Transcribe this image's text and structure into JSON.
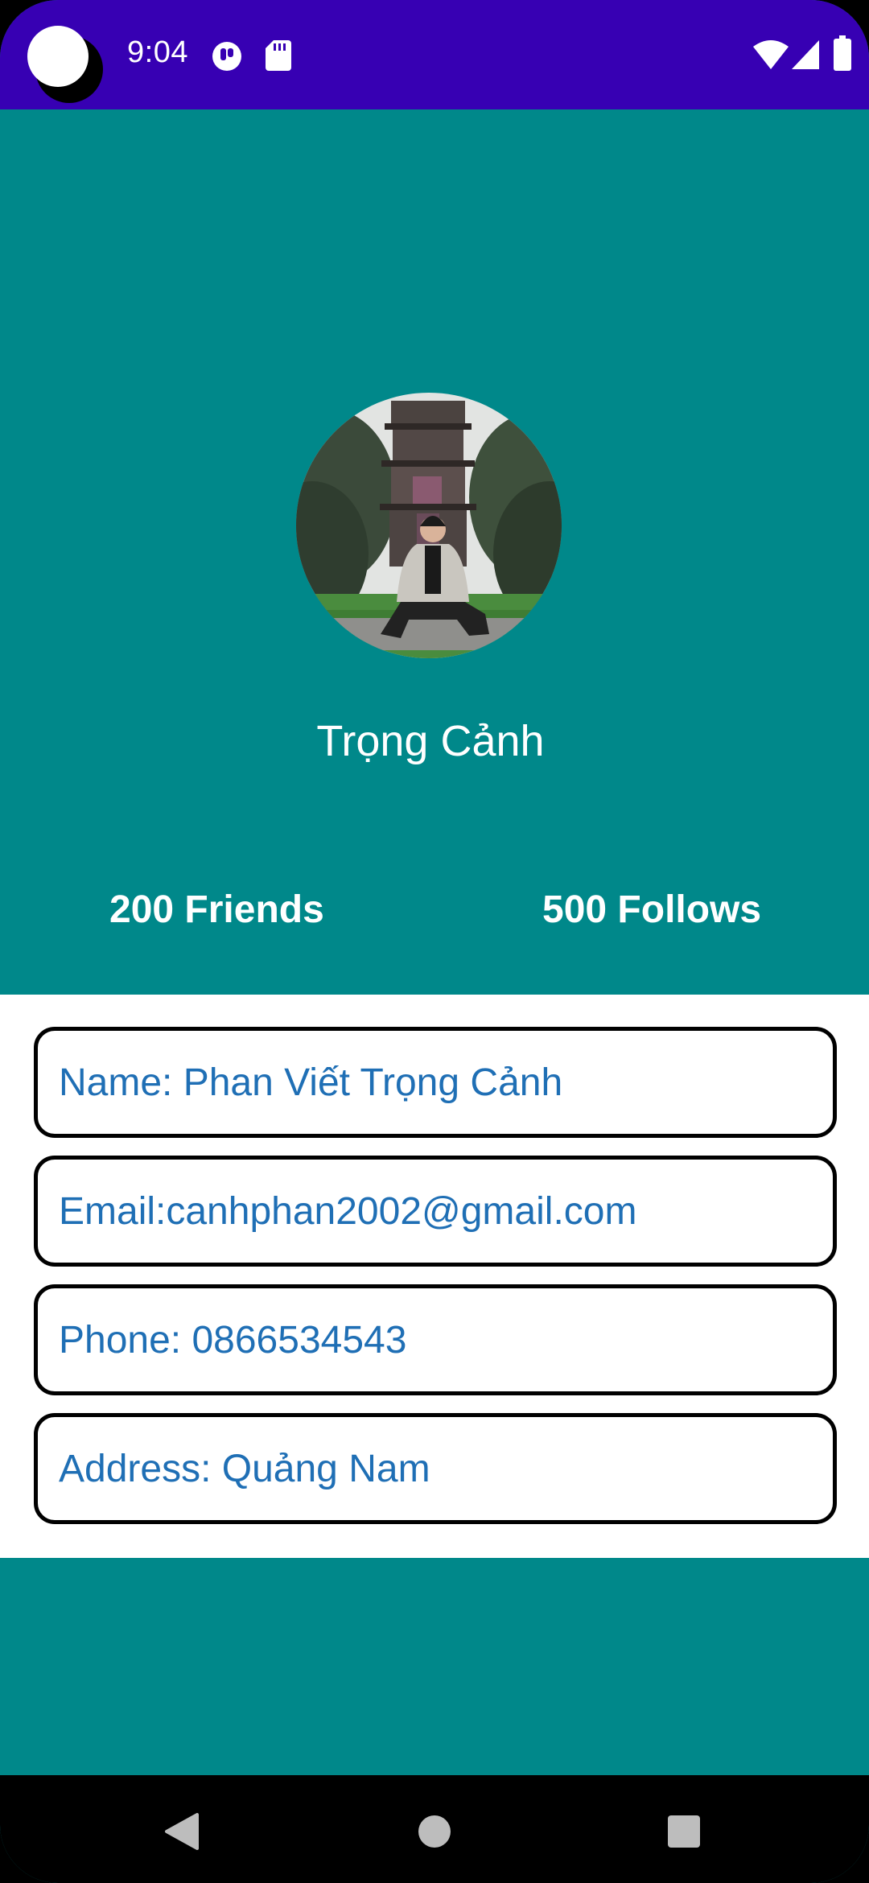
{
  "status_bar": {
    "time": "9:04",
    "icons": [
      "app-notification-icon",
      "sd-card-icon",
      "wifi-icon",
      "signal-icon",
      "battery-icon"
    ],
    "background_color": "#3700b3"
  },
  "profile": {
    "avatar_alt": "Trọng Cảnh",
    "name": "Trọng Cảnh",
    "friends": "200 Friends",
    "follows": "500 Follows"
  },
  "info": {
    "name": "Name: Phan Viết Trọng Cảnh",
    "email": "Email:canhphan2002@gmail.com",
    "phone": "Phone: 0866534543",
    "address": "Address: Quảng Nam"
  },
  "nav_bar": {
    "buttons": [
      "back-icon",
      "home-icon",
      "recents-icon"
    ]
  },
  "colors": {
    "header_background": "#00888a",
    "info_text": "#1f6fb5",
    "field_border": "#000000"
  }
}
